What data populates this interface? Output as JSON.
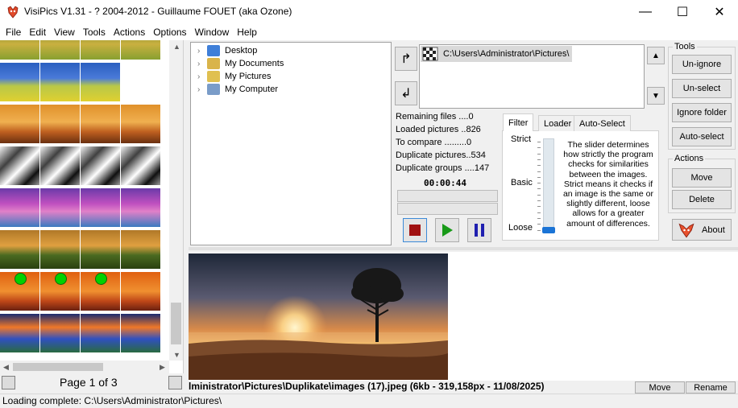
{
  "window": {
    "title": "VisiPics V1.31 - ? 2004-2012 - Guillaume FOUET (aka Ozone)",
    "minimize": "—",
    "maximize": "☐",
    "close": "✕"
  },
  "menu": [
    "File",
    "Edit",
    "View",
    "Tools",
    "Actions",
    "Options",
    "Window",
    "Help"
  ],
  "thumbnails": {
    "rows": [
      {
        "count": 4,
        "theme": "field",
        "markers": false
      },
      {
        "count": 3,
        "theme": "blue-mountain",
        "markers": false
      },
      {
        "count": 4,
        "theme": "sunset-tree",
        "markers": false
      },
      {
        "count": 4,
        "theme": "bw-waterfall",
        "markers": false
      },
      {
        "count": 4,
        "theme": "pink-blossom",
        "markers": false
      },
      {
        "count": 4,
        "theme": "green-sunset",
        "markers": false
      },
      {
        "count": 4,
        "theme": "orange-tree",
        "markers": true
      },
      {
        "count": 4,
        "theme": "blue-orange-sky",
        "markers": false
      }
    ],
    "page_label": "Page 1 of 3"
  },
  "tree": {
    "items": [
      {
        "label": "Desktop",
        "icon": "desktop-icon",
        "color": "#3f7fd8"
      },
      {
        "label": "My Documents",
        "icon": "documents-icon",
        "color": "#d9b44a"
      },
      {
        "label": "My Pictures",
        "icon": "pictures-icon",
        "color": "#e0c050"
      },
      {
        "label": "My Computer",
        "icon": "computer-icon",
        "color": "#7a9cc8"
      }
    ]
  },
  "paths": {
    "selected": "C:\\Users\\Administrator\\Pictures\\"
  },
  "stats": {
    "remaining": "Remaining files ....0",
    "loaded": "Loaded pictures ..826",
    "to_compare": "To compare .........0",
    "dup_pictures": "Duplicate pictures..534",
    "dup_groups": "Duplicate groups ....147",
    "timer": "00:00:44"
  },
  "tabs": [
    "Filter",
    "Loader",
    "Auto-Select"
  ],
  "filter": {
    "strict": "Strict",
    "basic": "Basic",
    "loose": "Loose",
    "level": 0.0,
    "description": "The slider determines how strictly the program checks for similarities between the images. Strict means it checks if an image is the same or slightly different, loose allows for a greater amount of differences."
  },
  "tools": {
    "group_label": "Tools",
    "unignore": "Un-ignore",
    "unselect": "Un-select",
    "ignore_folder": "Ignore folder",
    "autoselect": "Auto-select"
  },
  "actions": {
    "group_label": "Actions",
    "move": "Move",
    "delete": "Delete",
    "about": "About"
  },
  "preview": {
    "file_info": "lministrator\\Pictures\\Duplikate\\images (17).jpeg (6kb - 319,158px - 11/08/2025)",
    "move": "Move",
    "rename": "Rename"
  },
  "status": {
    "text": "Loading complete: C:\\Users\\Administrator\\Pictures\\"
  }
}
